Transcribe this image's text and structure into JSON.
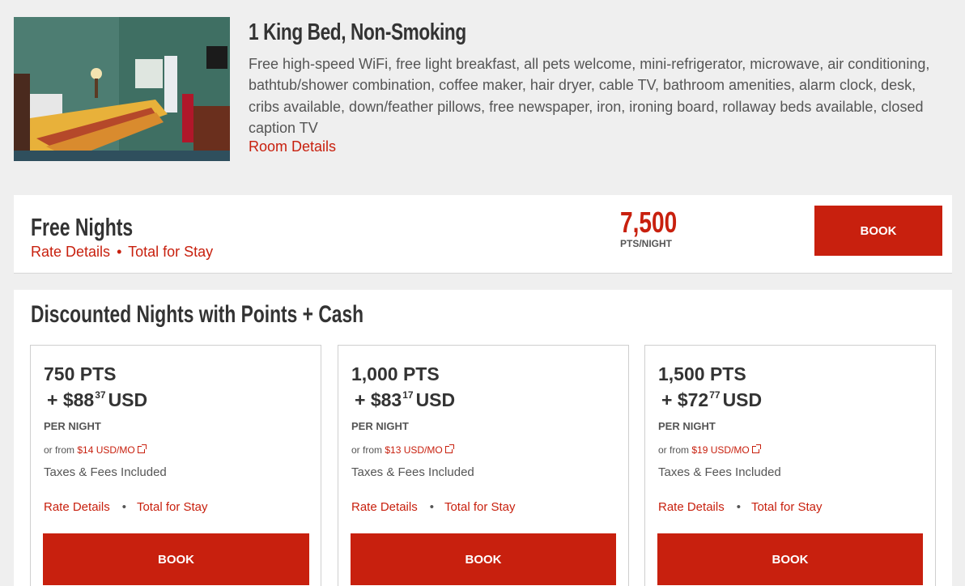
{
  "room": {
    "title": "1 King Bed, Non-Smoking",
    "description": "Free high-speed WiFi, free light breakfast, all pets welcome, mini-refrigerator, microwave, air conditioning, bathtub/shower combination, coffee maker, hair dryer, cable TV, bathroom amenities, alarm clock, desk, cribs available, down/feather pillows, free newspaper, iron, ironing board, rollaway beds available, closed caption TV",
    "details_link": "Room Details"
  },
  "free_nights": {
    "title": "Free Nights",
    "rate_details": "Rate Details",
    "separator": "•",
    "total_for_stay": "Total for Stay",
    "points": "7,500",
    "points_label": "PTS/NIGHT",
    "book_label": "BOOK"
  },
  "discounted": {
    "title": "Discounted Nights with Points + Cash",
    "cards": [
      {
        "points": "750 PTS",
        "cash_prefix": "+ $88",
        "cash_cents": "37",
        "cash_suffix": "USD",
        "per_night": "PER NIGHT",
        "or_from": "or from ",
        "monthly": "$14 USD/MO",
        "taxes": "Taxes & Fees Included",
        "rate_details": "Rate Details",
        "separator": "•",
        "total_for_stay": "Total for Stay",
        "book_label": "BOOK"
      },
      {
        "points": "1,000 PTS",
        "cash_prefix": "+ $83",
        "cash_cents": "17",
        "cash_suffix": "USD",
        "per_night": "PER NIGHT",
        "or_from": "or from ",
        "monthly": "$13 USD/MO",
        "taxes": "Taxes & Fees Included",
        "rate_details": "Rate Details",
        "separator": "•",
        "total_for_stay": "Total for Stay",
        "book_label": "BOOK"
      },
      {
        "points": "1,500 PTS",
        "cash_prefix": "+ $72",
        "cash_cents": "77",
        "cash_suffix": "USD",
        "per_night": "PER NIGHT",
        "or_from": "or from ",
        "monthly": "$19 USD/MO",
        "taxes": "Taxes & Fees Included",
        "rate_details": "Rate Details",
        "separator": "•",
        "total_for_stay": "Total for Stay",
        "book_label": "BOOK"
      }
    ]
  },
  "colors": {
    "accent": "#c8200e",
    "background": "#efefef",
    "text": "#333333"
  }
}
